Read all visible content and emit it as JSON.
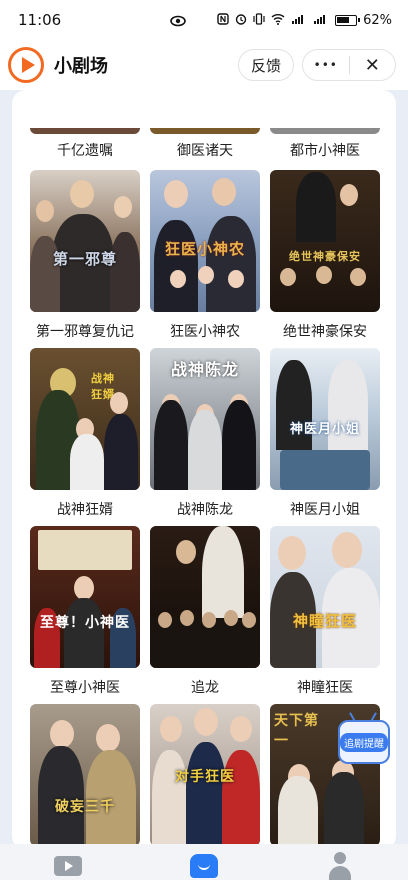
{
  "status_bar": {
    "time": "11:06",
    "battery": "62%"
  },
  "header": {
    "title": "小剧场",
    "feedback_label": "反馈",
    "more_label": "•••",
    "close_label": "✕"
  },
  "shows": [
    {
      "title": "千亿遗嘱",
      "art": ""
    },
    {
      "title": "御医诸天",
      "art": ""
    },
    {
      "title": "都市小神医",
      "art": ""
    },
    {
      "title": "第一邪尊复仇记",
      "art": "第一邪尊"
    },
    {
      "title": "狂医小神农",
      "art": "狂医小神农"
    },
    {
      "title": "绝世神豪保安",
      "art": "绝世神豪保安"
    },
    {
      "title": "战神狂婿",
      "art": "战神狂婿"
    },
    {
      "title": "战神陈龙",
      "art": "战神陈龙"
    },
    {
      "title": "神医月小姐",
      "art": "神医月小姐"
    },
    {
      "title": "至尊小神医",
      "art": "至尊！小神医"
    },
    {
      "title": "追龙",
      "art": ""
    },
    {
      "title": "神瞳狂医",
      "art": "神瞳狂医"
    },
    {
      "title": "",
      "art": "破妄三千"
    },
    {
      "title": "",
      "art": "对手狂医"
    },
    {
      "title": "",
      "art": "天下第一"
    }
  ],
  "float_badge": {
    "label": "追剧提醒"
  },
  "colors": {
    "accent": "#f26a21",
    "nav_active": "#2a7cf6"
  }
}
